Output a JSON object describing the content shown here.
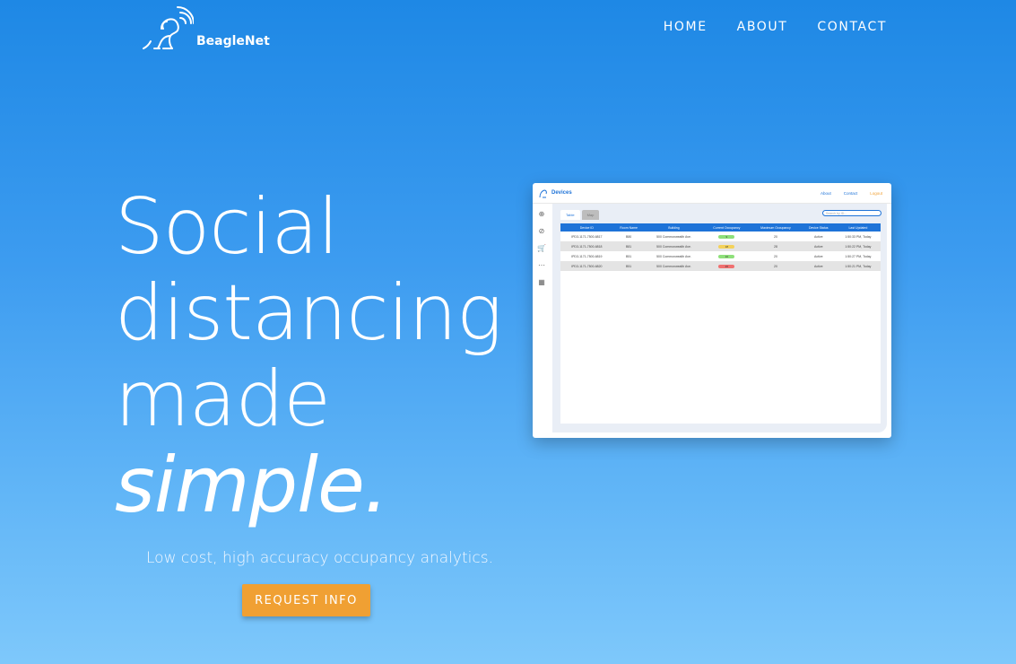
{
  "header": {
    "brand": "BeagleNet",
    "nav": [
      "HOME",
      "ABOUT",
      "CONTACT"
    ]
  },
  "hero": {
    "lines": [
      "Social",
      "distancing",
      "made",
      "simple."
    ],
    "subtitle": "Low cost, high accuracy occupancy analytics.",
    "cta_label": "REQUEST INFO"
  },
  "mockup": {
    "title": "Devices",
    "nav": [
      "About",
      "Contact",
      "Logout"
    ],
    "tabs": [
      "Table",
      "Map"
    ],
    "search_placeholder": "Search by ID...",
    "columns": [
      "Device ID",
      "Room Name",
      "Building",
      "Current Occupancy",
      "Maximum Occupancy",
      "Device Status",
      "Last Updated"
    ],
    "rows": [
      {
        "id": "IPD3-1171-7500-6817",
        "room": "B80",
        "building": "500 Commonwealth Ave.",
        "occ": "9",
        "occ_color": "#8ee07a",
        "max": "20",
        "status": "Active",
        "updated": "1:50:33 PM, Today"
      },
      {
        "id": "IPD3-1171-7500-6818",
        "room": "B81",
        "building": "500 Commonwealth Ave.",
        "occ": "18",
        "occ_color": "#f4d25a",
        "max": "28",
        "status": "Active",
        "updated": "1:50:22 PM, Today"
      },
      {
        "id": "IPD3-1171-7500-6819",
        "room": "B51",
        "building": "500 Commonwealth Ave.",
        "occ": "10",
        "occ_color": "#8ee07a",
        "max": "20",
        "status": "Active",
        "updated": "1:50:27 PM, Today"
      },
      {
        "id": "IPD3-1171-7500-6820",
        "room": "B51",
        "building": "500 Commonwealth Ave.",
        "occ": "26",
        "occ_color": "#f07070",
        "max": "20",
        "status": "Active",
        "updated": "1:50:21 PM, Today"
      }
    ]
  },
  "colors": {
    "accent": "#f0a033",
    "primary": "#1e88e5"
  }
}
